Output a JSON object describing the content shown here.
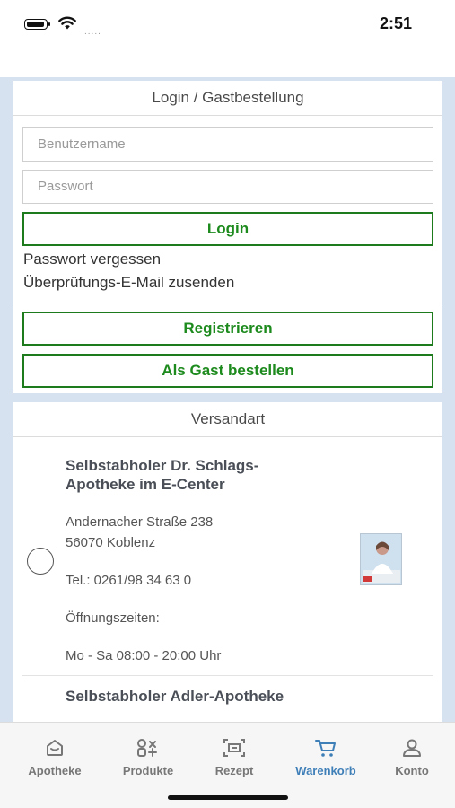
{
  "status_bar": {
    "time": "2:51",
    "signal": "....."
  },
  "login_card": {
    "title": "Login / Gastbestellung",
    "username_placeholder": "Benutzername",
    "password_placeholder": "Passwort",
    "login_label": "Login",
    "forgot_password": "Passwort vergessen",
    "send_verification": "Überprüfungs-E-Mail zusenden",
    "register_label": "Registrieren",
    "guest_order_label": "Als Gast bestellen"
  },
  "shipping_card": {
    "title": "Versandart",
    "options": [
      {
        "title": "Selbstabholer Dr. Schlags-Apotheke im E-Center",
        "street": "Andernacher Straße 238",
        "city": "56070 Koblenz",
        "phone": "Tel.: 0261/98 34 63 0",
        "hours_label": "Öffnungszeiten:",
        "hours": "Mo - Sa 08:00 - 20:00 Uhr"
      },
      {
        "title": "Selbstabholer Adler-Apotheke"
      }
    ]
  },
  "tab_bar": {
    "active": "Warenkorb",
    "active_color": "#3f7fb8",
    "inactive_color": "#777777",
    "items": [
      {
        "label": "Apotheke",
        "icon": "pharmacy-icon"
      },
      {
        "label": "Produkte",
        "icon": "products-icon"
      },
      {
        "label": "Rezept",
        "icon": "prescription-scan-icon"
      },
      {
        "label": "Warenkorb",
        "icon": "cart-icon"
      },
      {
        "label": "Konto",
        "icon": "account-icon"
      }
    ]
  },
  "colors": {
    "accent_green": "#1d8a1d",
    "background": "#d6e2ef"
  }
}
